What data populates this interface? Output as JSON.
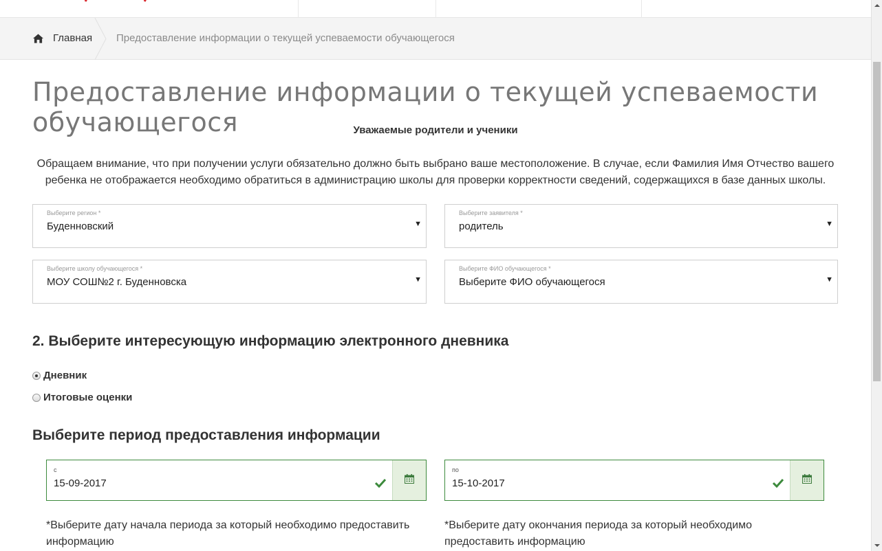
{
  "breadcrumb": {
    "home_label": "Главная",
    "current_label": "Предоставление информации о текущей успеваемости обучающегося"
  },
  "page": {
    "title": "Предоставление информации о текущей успеваемости обучающегося",
    "greeting": "Уважаемые родители и ученики",
    "notice": "Обращаем внимание, что при получении услуги обязательно должно быть выбрано ваше местоположение. В случае, если Фамилия Имя Отчество вашего ребенка не отображается необходимо обратиться в администрацию школы для проверки корректности сведений, содержащихся в базе данных школы."
  },
  "form": {
    "region": {
      "label": "Выберите регион *",
      "value": "Буденновский"
    },
    "applicant": {
      "label": "Выберите заявителя *",
      "value": "родитель"
    },
    "school": {
      "label": "Выберите школу обучающегося *",
      "value": "МОУ СОШ№2 г. Буденновска"
    },
    "student": {
      "label": "Выберите ФИО обучающегося *",
      "value": "Выберите ФИО обучающегося"
    },
    "caret": "▼"
  },
  "section_info": {
    "title": "2. Выберите интересующую информацию электронного дневника",
    "options": [
      {
        "label": "Дневник",
        "checked": true
      },
      {
        "label": "Итоговые оценки",
        "checked": false
      }
    ]
  },
  "period": {
    "title": "Выберите период предоставления информации",
    "from": {
      "label": "с",
      "value": "15-09-2017",
      "hint": "*Выберите дату начала периода за который необходимо предоставить информацию"
    },
    "to": {
      "label": "по",
      "value": "15-10-2017",
      "hint": "*Выберите дату окончания периода за который необходимо предоставить информацию"
    }
  },
  "colors": {
    "accent_green": "#3c8a3c",
    "brand_red": "#d9262c"
  },
  "icons": [
    "home-icon",
    "check-icon",
    "calendar-icon",
    "dropdown-caret-icon"
  ]
}
